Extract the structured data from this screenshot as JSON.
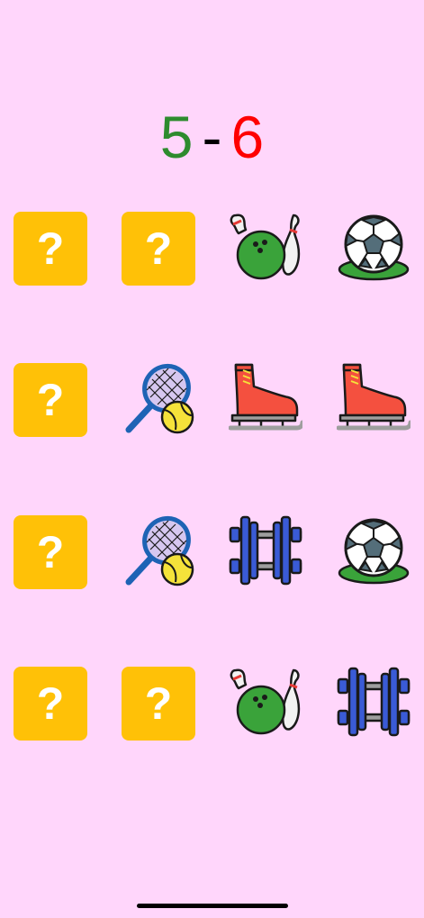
{
  "score": {
    "player1": "5",
    "separator": "-",
    "player2": "6",
    "player1_color": "#2e8b2e",
    "player2_color": "#ff0000"
  },
  "board": {
    "hidden_symbol": "?",
    "card_back_color": "#ffc107",
    "rows": [
      [
        "hidden",
        "hidden",
        "bowling",
        "soccer-ball"
      ],
      [
        "hidden",
        "tennis",
        "ice-skate",
        "ice-skate"
      ],
      [
        "hidden",
        "tennis",
        "dumbbell",
        "soccer-ball"
      ],
      [
        "hidden",
        "hidden",
        "bowling",
        "dumbbell"
      ]
    ]
  }
}
